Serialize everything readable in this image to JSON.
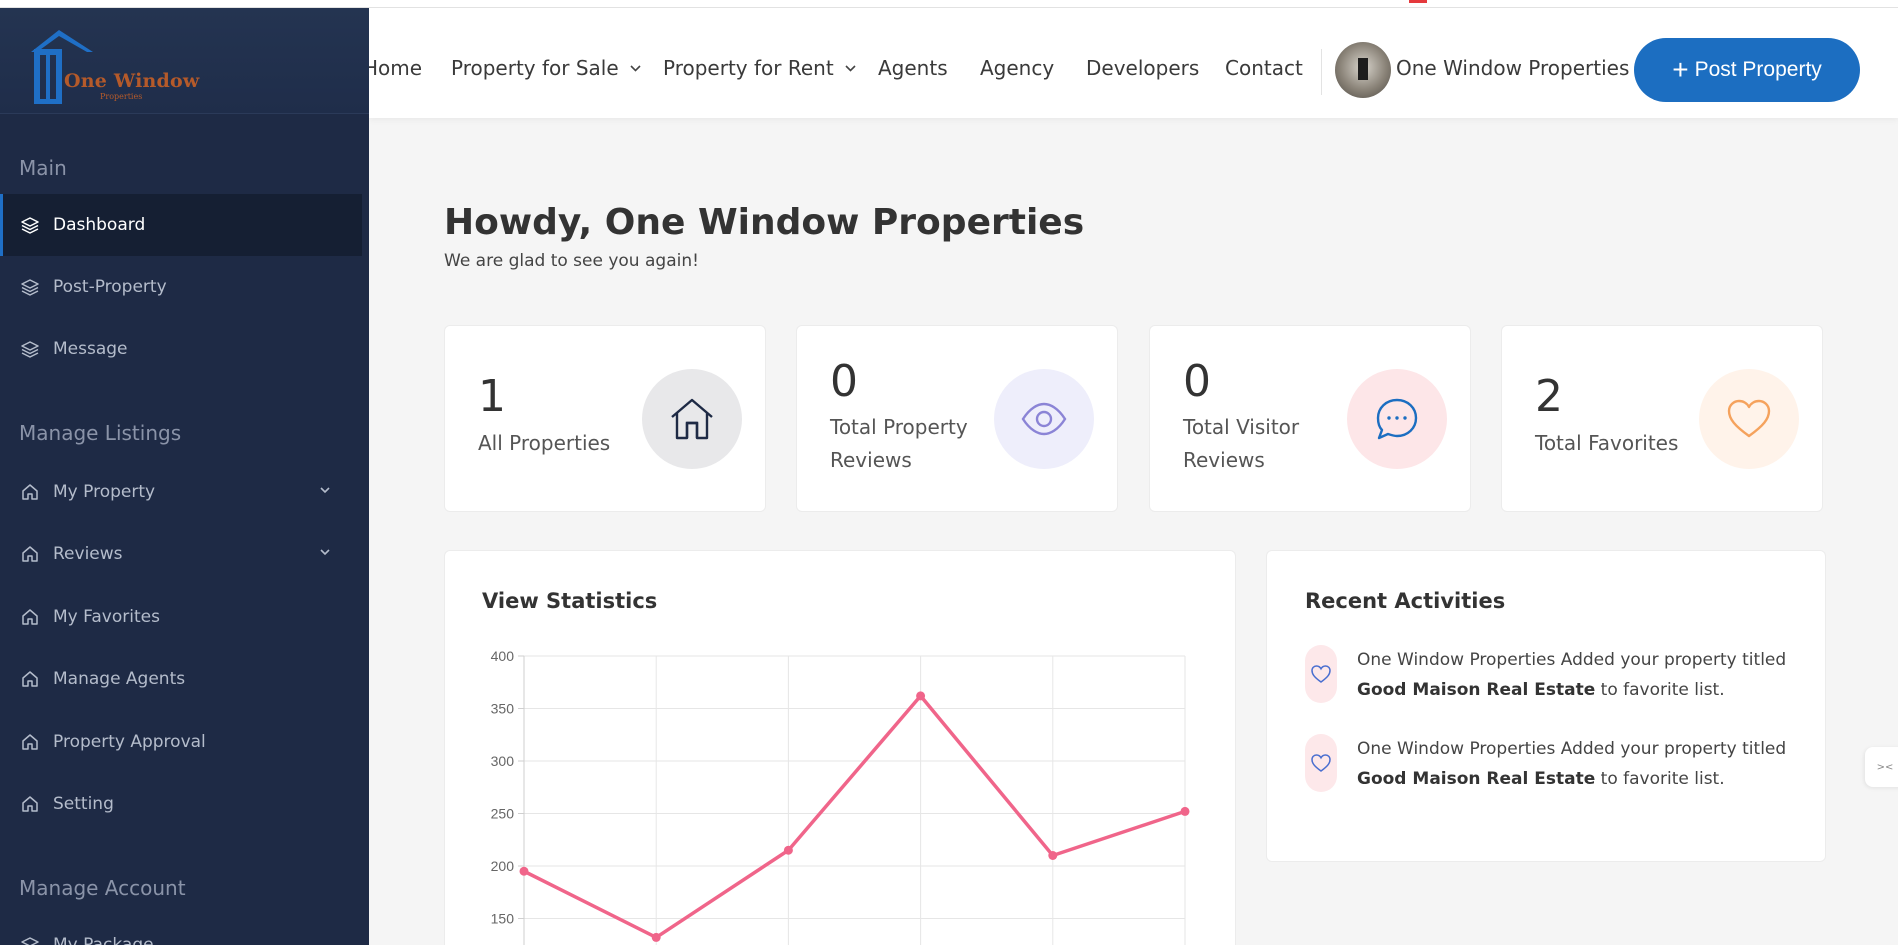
{
  "brand": {
    "logo_text": "One Window",
    "logo_sub": "Properties"
  },
  "sidebar": {
    "sections": [
      {
        "label": "Main"
      },
      {
        "label": "Manage Listings"
      },
      {
        "label": "Manage Account"
      }
    ],
    "items": [
      {
        "label": "Dashboard",
        "icon": "layers-icon",
        "active": true
      },
      {
        "label": "Post-Property",
        "icon": "layers-icon"
      },
      {
        "label": "Message",
        "icon": "layers-icon"
      },
      {
        "label": "My Property",
        "icon": "home-icon",
        "expandable": true
      },
      {
        "label": "Reviews",
        "icon": "home-icon",
        "expandable": true
      },
      {
        "label": "My Favorites",
        "icon": "home-icon"
      },
      {
        "label": "Manage Agents",
        "icon": "home-icon"
      },
      {
        "label": "Property Approval",
        "icon": "home-icon"
      },
      {
        "label": "Setting",
        "icon": "home-icon"
      },
      {
        "label": "My Package",
        "icon": "layers-icon"
      }
    ]
  },
  "header": {
    "nav": [
      {
        "label": "Home"
      },
      {
        "label": "Property for Sale",
        "dropdown": true
      },
      {
        "label": "Property for Rent",
        "dropdown": true
      },
      {
        "label": "Agents"
      },
      {
        "label": "Agency"
      },
      {
        "label": "Developers"
      },
      {
        "label": "Contact"
      }
    ],
    "user_name": "One Window Properties",
    "post_button": "Post Property"
  },
  "main": {
    "greeting": "Howdy, One Window Properties",
    "greeting_sub": "We are glad to see you again!",
    "stats": [
      {
        "value": "1",
        "label": "All Properties",
        "icon": "house-icon",
        "color": "#e8e8ea"
      },
      {
        "value": "0",
        "label": "Total Property Reviews",
        "icon": "eye-icon",
        "color": "#eeeefb"
      },
      {
        "value": "0",
        "label": "Total Visitor Reviews",
        "icon": "chat-icon",
        "color": "#fde6e8"
      },
      {
        "value": "2",
        "label": "Total Favorites",
        "icon": "heart-icon",
        "color": "#fff3ea"
      }
    ],
    "view_stats_title": "View Statistics",
    "recent_title": "Recent Activities",
    "activities": [
      {
        "prefix": "One Window Properties Added your property titled",
        "title": "Good Maison Real Estate",
        "suffix": "to favorite list."
      },
      {
        "prefix": "One Window Properties Added your property titled",
        "title": "Good Maison Real Estate",
        "suffix": "to favorite list."
      }
    ]
  },
  "colors": {
    "sidebar_bg": "#1e2a45",
    "accent": "#1c6ec1",
    "line": "#f0658a"
  },
  "chart_data": {
    "type": "line",
    "title": "View Statistics",
    "y_ticks": [
      "400",
      "350",
      "300",
      "250",
      "200",
      "150"
    ],
    "ylim": [
      150,
      400
    ],
    "grid": true,
    "series": [
      {
        "values": [
          195,
          132,
          215,
          362,
          210,
          252
        ]
      }
    ]
  }
}
